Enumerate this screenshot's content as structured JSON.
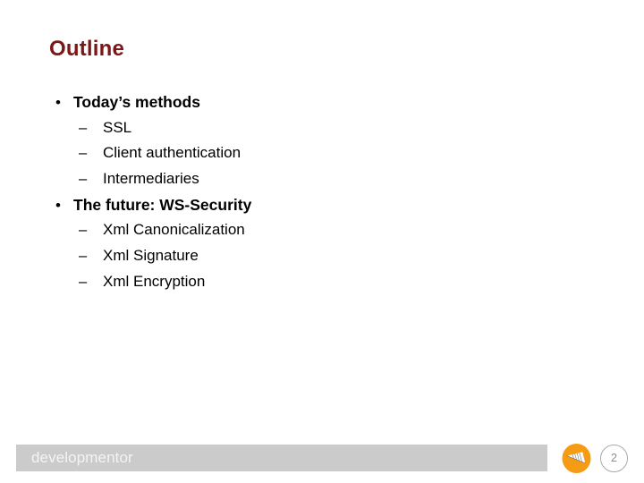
{
  "slide": {
    "title": "Outline",
    "title_color": "#7c1715",
    "background_color": "#ffffff",
    "outline": [
      {
        "level": 1,
        "marker": "•",
        "text": "Today’s methods"
      },
      {
        "level": 2,
        "marker": "–",
        "text": "SSL"
      },
      {
        "level": 2,
        "marker": "–",
        "text": "Client authentication"
      },
      {
        "level": 2,
        "marker": "–",
        "text": "Intermediaries"
      },
      {
        "level": 1,
        "marker": "•",
        "text": "The future: WS-Security"
      },
      {
        "level": 2,
        "marker": "–",
        "text": "Xml Canonicalization"
      },
      {
        "level": 2,
        "marker": "–",
        "text": "Xml Signature"
      },
      {
        "level": 2,
        "marker": "–",
        "text": "Xml Encryption"
      }
    ]
  },
  "footer": {
    "brand": "developmentor",
    "bar_color": "#cbcbcb",
    "brand_color": "#f4f4f4",
    "logo_icon": "developmentor-swoosh-logo",
    "logo_color": "#f59c14",
    "page_number": "2",
    "page_number_color": "#8f8f8f"
  }
}
